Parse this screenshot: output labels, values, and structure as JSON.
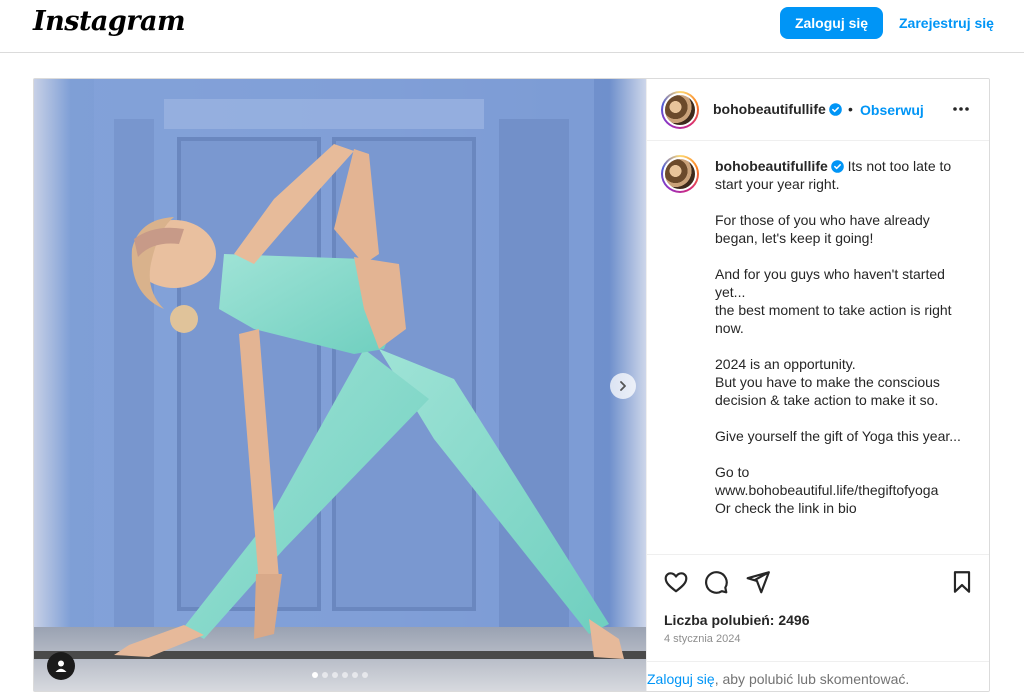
{
  "header": {
    "logo": "Instagram",
    "login_label": "Zaloguj się",
    "register_label": "Zarejestruj się"
  },
  "post": {
    "username": "bohobeautifullife",
    "follow_label": "Obserwuj",
    "separator": "•",
    "caption_first": "Its not too late to start your year right.",
    "caption_paragraphs": [
      "For those of you who have already began, let's keep it going!",
      "And for you guys who haven't started yet...\nthe best moment to take action is right now.",
      "2024 is an opportunity.\nBut you have to make the conscious decision & take action to make it so.",
      "Give yourself the gift of Yoga this year...",
      "Go to www.bohobeautiful.life/thegiftofyoga\nOr check the link in bio"
    ],
    "likes_text": "Liczba polubień: 2496",
    "date": "4 stycznia 2024",
    "login_prompt_link": "Zaloguj się",
    "login_prompt_rest": ", aby polubić lub skomentować.",
    "carousel": {
      "count": 6,
      "active": 0
    }
  },
  "icons": [
    "heart-icon",
    "comment-icon",
    "share-icon",
    "bookmark-icon",
    "more-icon",
    "chevron-right-icon",
    "user-tag-icon",
    "verified-badge-icon"
  ],
  "colors": {
    "accent": "#0095f6",
    "border": "#dbdbdb",
    "text": "#262626",
    "muted": "#8e8e8e"
  }
}
